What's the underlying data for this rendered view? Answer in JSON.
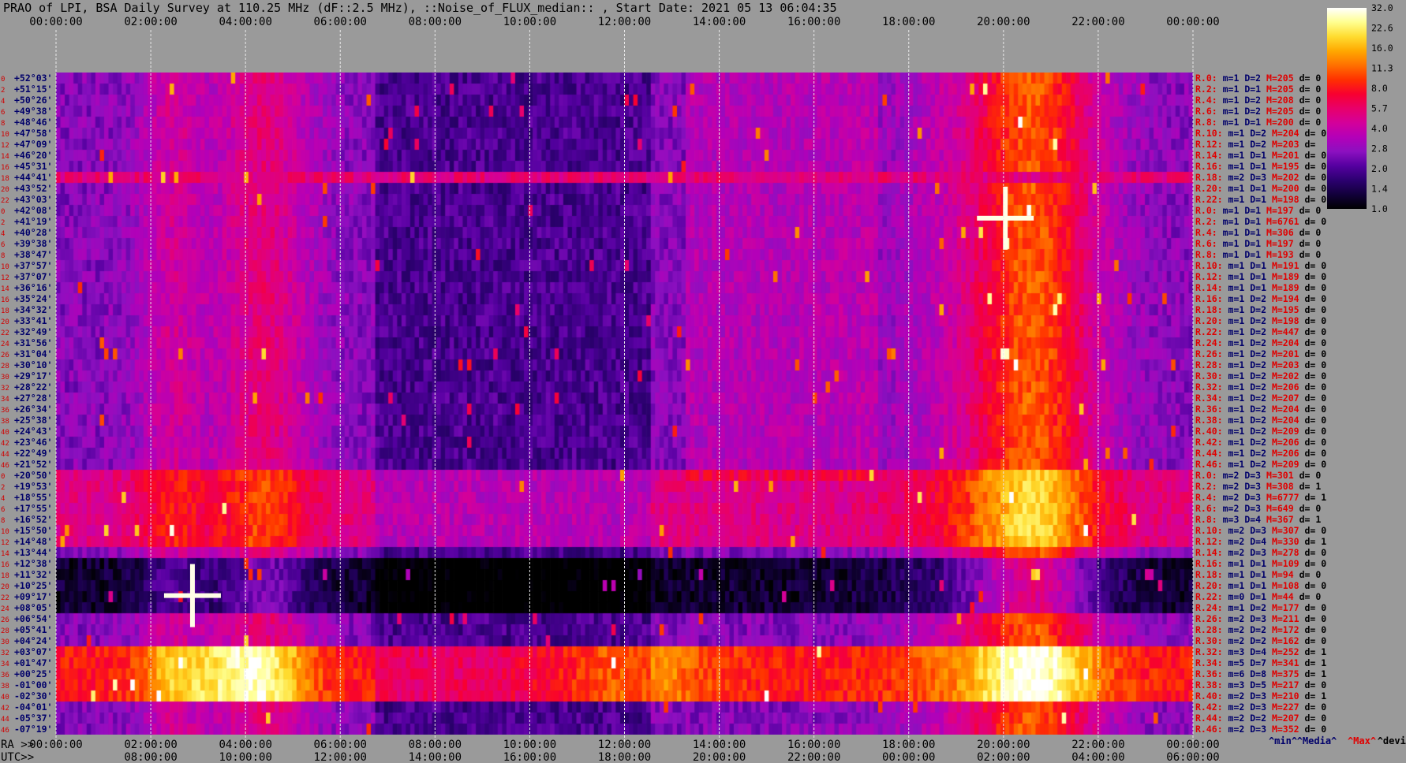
{
  "title": "PRAO of LPI, BSA Daily Survey at 110.25 MHz (dF::2.5 MHz), ::Noise_of_FLUX_median:: , Start Date: 2021 05 13 06:04:35",
  "colors": {
    "background": "#9a9a9a",
    "stat_red": "#e00000",
    "stat_navy": "#00006a",
    "legend_min": "#00006a",
    "legend_median": "#00006a",
    "legend_max": "#e00000",
    "legend_devia": "#000000"
  },
  "chart_data": {
    "type": "heatmap",
    "title": "PRAO of LPI, BSA Daily Survey at 110.25 MHz (dF::2.5 MHz), ::Noise_of_FLUX_median:: , Start Date: 2021 05 13 06:04:35",
    "x_top_ticks": [
      "00:00:00",
      "02:00:00",
      "04:00:00",
      "06:00:00",
      "08:00:00",
      "10:00:00",
      "12:00:00",
      "14:00:00",
      "16:00:00",
      "18:00:00",
      "20:00:00",
      "22:00:00",
      "00:00:00"
    ],
    "ra_axis_prefix": "RA >>",
    "ra_ticks": [
      "00:00:00",
      "02:00:00",
      "04:00:00",
      "06:00:00",
      "08:00:00",
      "10:00:00",
      "12:00:00",
      "14:00:00",
      "16:00:00",
      "18:00:00",
      "20:00:00",
      "22:00:00",
      "00:00:00"
    ],
    "utc_axis_prefix": "UTC>>",
    "utc_ticks": [
      "08:00:00",
      "10:00:00",
      "12:00:00",
      "14:00:00",
      "16:00:00",
      "18:00:00",
      "20:00:00",
      "22:00:00",
      "00:00:00",
      "02:00:00",
      "04:00:00",
      "06:00:00"
    ],
    "declinations": [
      "+52°03'",
      "+51°15'",
      "+50°26'",
      "+49°38'",
      "+48°46'",
      "+47°58'",
      "+47°09'",
      "+46°20'",
      "+45°31'",
      "+44°41'",
      "+43°52'",
      "+43°03'",
      "+42°08'",
      "+41°19'",
      "+40°28'",
      "+39°38'",
      "+38°47'",
      "+37°57'",
      "+37°07'",
      "+36°16'",
      "+35°24'",
      "+34°32'",
      "+33°41'",
      "+32°49'",
      "+31°56'",
      "+31°04'",
      "+30°10'",
      "+29°17'",
      "+28°22'",
      "+27°28'",
      "+26°34'",
      "+25°38'",
      "+24°43'",
      "+23°46'",
      "+22°49'",
      "+21°52'",
      "+20°50'",
      "+19°53'",
      "+18°55'",
      "+17°55'",
      "+16°52'",
      "+15°50'",
      "+14°48'",
      "+13°44'",
      "+12°38'",
      "+11°32'",
      "+10°25'",
      "+09°17'",
      "+08°05'",
      "+06°54'",
      "+05°41'",
      "+04°24'",
      "+03°07'",
      "+01°47'",
      "+00°25'",
      "-01°00'",
      "-02°30'",
      "-04°01'",
      "-05°37'",
      "-07°19'"
    ],
    "row_index_labels": [
      "0",
      "2",
      "4",
      "6",
      "8",
      "10",
      "12",
      "14",
      "16",
      "18",
      "20",
      "22",
      "0",
      "2",
      "4",
      "6",
      "8",
      "10",
      "12",
      "14",
      "16",
      "18",
      "20",
      "22",
      "24",
      "26",
      "28",
      "30",
      "32",
      "34",
      "36",
      "38",
      "40",
      "42",
      "44",
      "46",
      "0",
      "2",
      "4",
      "6",
      "8",
      "10",
      "12",
      "14",
      "16",
      "18",
      "20",
      "22",
      "24",
      "26",
      "28",
      "30",
      "32",
      "34",
      "36",
      "38",
      "40",
      "42",
      "44",
      "46"
    ],
    "statistics": [
      {
        "r": "R.0:",
        "m": "m=1",
        "D": "D=2",
        "M": "M=205",
        "d": "d= 0"
      },
      {
        "r": "R.2:",
        "m": "m=1",
        "D": "D=1",
        "M": "M=205",
        "d": "d= 0"
      },
      {
        "r": "R.4:",
        "m": "m=1",
        "D": "D=2",
        "M": "M=208",
        "d": "d= 0"
      },
      {
        "r": "R.6:",
        "m": "m=1",
        "D": "D=2",
        "M": "M=205",
        "d": "d= 0"
      },
      {
        "r": "R.8:",
        "m": "m=1",
        "D": "D=1",
        "M": "M=200",
        "d": "d= 0"
      },
      {
        "r": "R.10:",
        "m": "m=1",
        "D": "D=2",
        "M": "M=204",
        "d": "d= 0"
      },
      {
        "r": "R.12:",
        "m": "m=1",
        "D": "D=2",
        "M": "M=203",
        "d": "d="
      },
      {
        "r": "R.14:",
        "m": "m=1",
        "D": "D=1",
        "M": "M=201",
        "d": "d= 0"
      },
      {
        "r": "R.16:",
        "m": "m=1",
        "D": "D=1",
        "M": "M=195",
        "d": "d= 0"
      },
      {
        "r": "R.18:",
        "m": "m=2",
        "D": "D=3",
        "M": "M=202",
        "d": "d= 0"
      },
      {
        "r": "R.20:",
        "m": "m=1",
        "D": "D=1",
        "M": "M=200",
        "d": "d= 0"
      },
      {
        "r": "R.22:",
        "m": "m=1",
        "D": "D=1",
        "M": "M=198",
        "d": "d= 0"
      },
      {
        "r": "R.0:",
        "m": "m=1",
        "D": "D=1",
        "M": "M=197",
        "d": "d= 0"
      },
      {
        "r": "R.2:",
        "m": "m=1",
        "D": "D=1",
        "M": "M=6761",
        "d": "d= 0"
      },
      {
        "r": "R.4:",
        "m": "m=1",
        "D": "D=1",
        "M": "M=306",
        "d": "d= 0"
      },
      {
        "r": "R.6:",
        "m": "m=1",
        "D": "D=1",
        "M": "M=197",
        "d": "d= 0"
      },
      {
        "r": "R.8:",
        "m": "m=1",
        "D": "D=1",
        "M": "M=193",
        "d": "d= 0"
      },
      {
        "r": "R.10:",
        "m": "m=1",
        "D": "D=1",
        "M": "M=191",
        "d": "d= 0"
      },
      {
        "r": "R.12:",
        "m": "m=1",
        "D": "D=1",
        "M": "M=189",
        "d": "d= 0"
      },
      {
        "r": "R.14:",
        "m": "m=1",
        "D": "D=1",
        "M": "M=189",
        "d": "d= 0"
      },
      {
        "r": "R.16:",
        "m": "m=1",
        "D": "D=2",
        "M": "M=194",
        "d": "d= 0"
      },
      {
        "r": "R.18:",
        "m": "m=1",
        "D": "D=2",
        "M": "M=195",
        "d": "d= 0"
      },
      {
        "r": "R.20:",
        "m": "m=1",
        "D": "D=2",
        "M": "M=198",
        "d": "d= 0"
      },
      {
        "r": "R.22:",
        "m": "m=1",
        "D": "D=2",
        "M": "M=447",
        "d": "d= 0"
      },
      {
        "r": "R.24:",
        "m": "m=1",
        "D": "D=2",
        "M": "M=204",
        "d": "d= 0"
      },
      {
        "r": "R.26:",
        "m": "m=1",
        "D": "D=2",
        "M": "M=201",
        "d": "d= 0"
      },
      {
        "r": "R.28:",
        "m": "m=1",
        "D": "D=2",
        "M": "M=203",
        "d": "d= 0"
      },
      {
        "r": "R.30:",
        "m": "m=1",
        "D": "D=2",
        "M": "M=202",
        "d": "d= 0"
      },
      {
        "r": "R.32:",
        "m": "m=1",
        "D": "D=2",
        "M": "M=206",
        "d": "d= 0"
      },
      {
        "r": "R.34:",
        "m": "m=1",
        "D": "D=2",
        "M": "M=207",
        "d": "d= 0"
      },
      {
        "r": "R.36:",
        "m": "m=1",
        "D": "D=2",
        "M": "M=204",
        "d": "d= 0"
      },
      {
        "r": "R.38:",
        "m": "m=1",
        "D": "D=2",
        "M": "M=204",
        "d": "d= 0"
      },
      {
        "r": "R.40:",
        "m": "m=1",
        "D": "D=2",
        "M": "M=209",
        "d": "d= 0"
      },
      {
        "r": "R.42:",
        "m": "m=1",
        "D": "D=2",
        "M": "M=206",
        "d": "d= 0"
      },
      {
        "r": "R.44:",
        "m": "m=1",
        "D": "D=2",
        "M": "M=206",
        "d": "d= 0"
      },
      {
        "r": "R.46:",
        "m": "m=1",
        "D": "D=2",
        "M": "M=209",
        "d": "d= 0"
      },
      {
        "r": "R.0:",
        "m": "m=2",
        "D": "D=3",
        "M": "M=301",
        "d": "d= 0"
      },
      {
        "r": "R.2:",
        "m": "m=2",
        "D": "D=3",
        "M": "M=308",
        "d": "d= 1"
      },
      {
        "r": "R.4:",
        "m": "m=2",
        "D": "D=3",
        "M": "M=6777",
        "d": "d= 1"
      },
      {
        "r": "R.6:",
        "m": "m=2",
        "D": "D=3",
        "M": "M=649",
        "d": "d= 0"
      },
      {
        "r": "R.8:",
        "m": "m=3",
        "D": "D=4",
        "M": "M=367",
        "d": "d= 1"
      },
      {
        "r": "R.10:",
        "m": "m=2",
        "D": "D=3",
        "M": "M=307",
        "d": "d= 0"
      },
      {
        "r": "R.12:",
        "m": "m=2",
        "D": "D=4",
        "M": "M=330",
        "d": "d= 1"
      },
      {
        "r": "R.14:",
        "m": "m=2",
        "D": "D=3",
        "M": "M=278",
        "d": "d= 0"
      },
      {
        "r": "R.16:",
        "m": "m=1",
        "D": "D=1",
        "M": "M=109",
        "d": "d= 0"
      },
      {
        "r": "R.18:",
        "m": "m=1",
        "D": "D=1",
        "M": "M=94",
        "d": "d= 0"
      },
      {
        "r": "R.20:",
        "m": "m=1",
        "D": "D=1",
        "M": "M=108",
        "d": "d= 0"
      },
      {
        "r": "R.22:",
        "m": "m=0",
        "D": "D=1",
        "M": "M=44",
        "d": "d= 0"
      },
      {
        "r": "R.24:",
        "m": "m=1",
        "D": "D=2",
        "M": "M=177",
        "d": "d= 0"
      },
      {
        "r": "R.26:",
        "m": "m=2",
        "D": "D=3",
        "M": "M=211",
        "d": "d= 0"
      },
      {
        "r": "R.28:",
        "m": "m=2",
        "D": "D=2",
        "M": "M=172",
        "d": "d= 0"
      },
      {
        "r": "R.30:",
        "m": "m=2",
        "D": "D=2",
        "M": "M=162",
        "d": "d= 0"
      },
      {
        "r": "R.32:",
        "m": "m=3",
        "D": "D=4",
        "M": "M=252",
        "d": "d= 1"
      },
      {
        "r": "R.34:",
        "m": "m=5",
        "D": "D=7",
        "M": "M=341",
        "d": "d= 1"
      },
      {
        "r": "R.36:",
        "m": "m=6",
        "D": "D=8",
        "M": "M=375",
        "d": "d= 1"
      },
      {
        "r": "R.38:",
        "m": "m=3",
        "D": "D=5",
        "M": "M=217",
        "d": "d= 0"
      },
      {
        "r": "R.40:",
        "m": "m=2",
        "D": "D=3",
        "M": "M=210",
        "d": "d= 1"
      },
      {
        "r": "R.42:",
        "m": "m=2",
        "D": "D=3",
        "M": "M=227",
        "d": "d= 0"
      },
      {
        "r": "R.44:",
        "m": "m=2",
        "D": "D=2",
        "M": "M=207",
        "d": "d= 0"
      },
      {
        "r": "R.46:",
        "m": "m=2",
        "D": "D=3",
        "M": "M=352",
        "d": "d= 0"
      }
    ],
    "legend": [
      "^min^",
      "^Media^",
      "^Max^",
      "^devia^"
    ],
    "colorbar": {
      "scale": "log",
      "range": [
        1.0,
        32.0
      ],
      "ticks": [
        "32.0",
        "22.6",
        "16.0",
        "11.3",
        "8.0",
        "5.7",
        "4.0",
        "2.8",
        "2.0",
        "1.4",
        "1.0"
      ],
      "colormap": [
        "#000000",
        "#12003a",
        "#2c0070",
        "#5500a0",
        "#8c10c0",
        "#b400b8",
        "#d4009a",
        "#e8006a",
        "#f80030",
        "#ff3000",
        "#ff7000",
        "#ffa800",
        "#ffdc30",
        "#ffff90",
        "#ffffff"
      ]
    }
  }
}
